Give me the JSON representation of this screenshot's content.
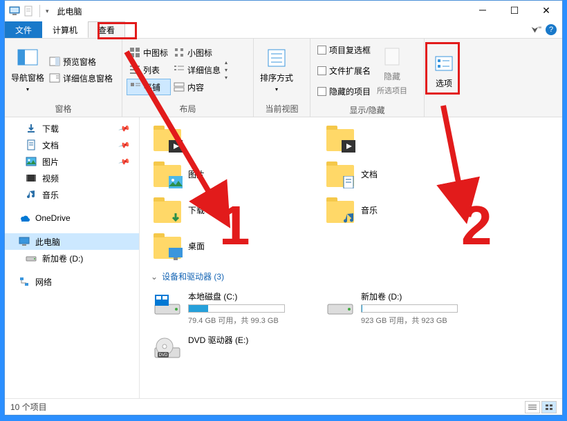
{
  "title": "此电脑",
  "tabs": {
    "file": "文件",
    "computer": "计算机",
    "view": "查看"
  },
  "ribbon": {
    "pane": {
      "nav": "导航窗格",
      "preview": "预览窗格",
      "details": "详细信息窗格",
      "group": "窗格"
    },
    "layout": {
      "medium": "中图标",
      "small": "小图标",
      "list": "列表",
      "details": "详细信息",
      "tiles": "平铺",
      "content": "内容",
      "group": "布局"
    },
    "current": {
      "sort": "排序方式",
      "group": "当前视图"
    },
    "showhide": {
      "checkboxes": "项目复选框",
      "extensions": "文件扩展名",
      "hidden": "隐藏的项目",
      "hidebtn": "隐藏",
      "hidebtn2": "所选项目",
      "group": "显示/隐藏"
    },
    "options": "选项"
  },
  "nav": {
    "downloads": "下载",
    "documents": "文档",
    "pictures": "图片",
    "videos": "视频",
    "music": "音乐",
    "onedrive": "OneDrive",
    "thispc": "此电脑",
    "newvol": "新加卷 (D:)",
    "network": "网络"
  },
  "folders": {
    "pictures": "图片",
    "documents": "文档",
    "downloads": "下载",
    "music": "音乐",
    "desktop": "桌面"
  },
  "group_devices": "设备和驱动器 (3)",
  "drives": {
    "c": {
      "name": "本地磁盘 (C:)",
      "sub": "79.4 GB 可用，共 99.3 GB",
      "pct": 20
    },
    "d": {
      "name": "新加卷 (D:)",
      "sub": "923 GB 可用，共 923 GB",
      "pct": 1
    },
    "e": {
      "name": "DVD 驱动器 (E:)"
    }
  },
  "status": "10 个项目",
  "annot": {
    "one": "1",
    "two": "2"
  }
}
